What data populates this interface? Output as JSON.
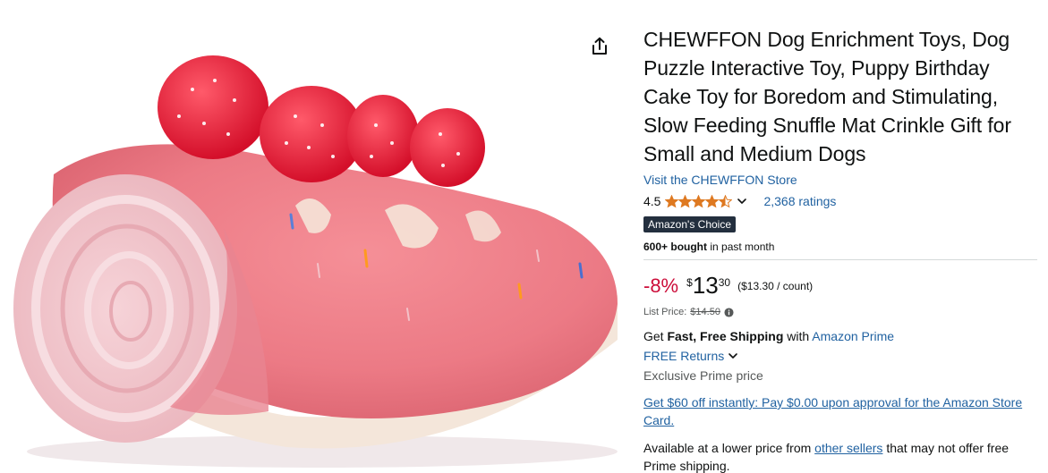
{
  "product": {
    "title": "CHEWFFON Dog Enrichment Toys, Dog Puzzle Interactive Toy, Puppy Birthday Cake Toy for Boredom and Stimulating, Slow Feeding Snuffle Mat Crinkle Gift for Small and Medium Dogs",
    "store_link": "Visit the CHEWFFON Store",
    "rating_value": "4.5",
    "rating_stars": 4.5,
    "ratings_count": "2,368 ratings",
    "badge": "Amazon's Choice",
    "bought_bold": "600+ bought",
    "bought_rest": " in past month"
  },
  "price": {
    "discount": "-8%",
    "currency": "$",
    "whole": "13",
    "fraction": "30",
    "unit_price": "($13.30 / count)",
    "list_price_label": "List Price:",
    "list_price_value": "$14.50"
  },
  "shipping": {
    "get": "Get ",
    "fast_free": "Fast, Free Shipping",
    "with": " with ",
    "prime_link": "Amazon Prime",
    "free_returns": "FREE Returns",
    "exclusive": "Exclusive Prime price"
  },
  "offers": {
    "store_card": "Get $60 off instantly: Pay $0.00 upon approval for the Amazon Store Card.",
    "lower_price_prefix": "Available at a lower price from ",
    "other_sellers": "other sellers",
    "lower_price_suffix": " that may not offer free Prime shipping."
  },
  "colors": {
    "link": "#2162a1",
    "discount": "#cc0c39",
    "star": "#de7921",
    "badge_bg": "#232f3e"
  },
  "icons": {
    "share": "share-icon",
    "star": "star-icon",
    "chevron": "chevron-down-icon",
    "info": "info-icon"
  }
}
